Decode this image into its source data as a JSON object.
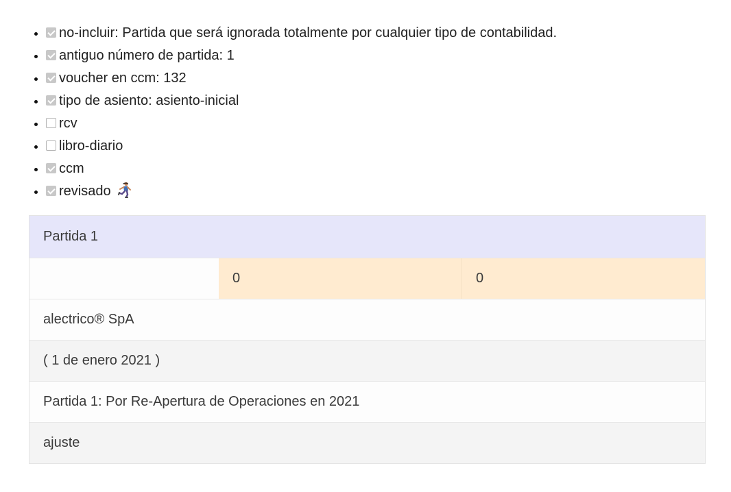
{
  "checklist": [
    {
      "label": "no-incluir: Partida que será ignorada totalmente por cualquier tipo de contabilidad.",
      "checked": true
    },
    {
      "label": "antiguo número de partida: 1",
      "checked": true
    },
    {
      "label": "voucher en ccm: 132",
      "checked": true
    },
    {
      "label": "tipo de asiento: asiento-inicial",
      "checked": true
    },
    {
      "label": "rcv",
      "checked": false
    },
    {
      "label": "libro-diario",
      "checked": false
    },
    {
      "label": "ccm",
      "checked": true
    },
    {
      "label": "revisado",
      "checked": true,
      "icon": "runner-icon"
    }
  ],
  "entry": {
    "title": "Partida 1",
    "debit": "0",
    "credit": "0",
    "company": "alectrico® SpA",
    "date": "( 1 de enero 2021 )",
    "description": "Partida 1: Por Re-Apertura de Operaciones en 2021",
    "category": "ajuste"
  },
  "colors": {
    "header_bg": "#e6e6fa",
    "amount_bg": "#ffebd0",
    "checkbox_checked": "#c8c8c8"
  }
}
